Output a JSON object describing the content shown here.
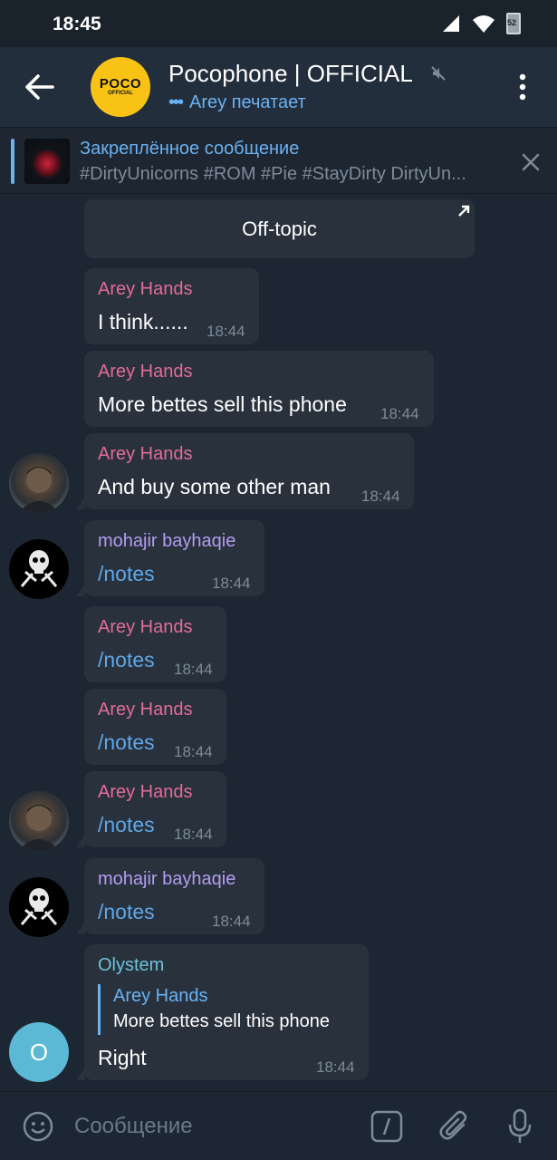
{
  "status_bar": {
    "time": "18:45",
    "battery": "52"
  },
  "header": {
    "title": "Pocophone | OFFICIAL",
    "avatar_logo": "POCO",
    "avatar_logo_sub": "OFFICIAL",
    "typing_dots": "•••",
    "status": "Arey печатает"
  },
  "pinned": {
    "title": "Закреплённое сообщение",
    "text": "#DirtyUnicorns #ROM #Pie #StayDirty DirtyUn..."
  },
  "topic": {
    "label": "Off-topic"
  },
  "messages": [
    {
      "sender": "Arey Hands",
      "text": "I think......",
      "time": "18:44"
    },
    {
      "sender": "Arey Hands",
      "text": "More bettes sell this phone",
      "time": "18:44"
    },
    {
      "sender": "Arey Hands",
      "text": "And buy some other man",
      "time": "18:44"
    },
    {
      "sender": "mohajir bayhaqie",
      "text": "/notes",
      "time": "18:44"
    },
    {
      "sender": "Arey Hands",
      "text": "/notes",
      "time": "18:44"
    },
    {
      "sender": "Arey Hands",
      "text": "/notes",
      "time": "18:44"
    },
    {
      "sender": "Arey Hands",
      "text": "/notes",
      "time": "18:44"
    },
    {
      "sender": "mohajir bayhaqie",
      "text": "/notes",
      "time": "18:44"
    },
    {
      "sender": "Olystem",
      "reply_name": "Arey Hands",
      "reply_text": "More bettes sell this phone",
      "text": "Right",
      "time": "18:44",
      "avatar_letter": "O"
    }
  ],
  "input": {
    "placeholder": "Сообщение"
  },
  "colors": {
    "background": "#1d2733",
    "header": "#232e3c",
    "bubble": "#28313c",
    "accent": "#6ab2f2",
    "name_arey": "#e56b9a",
    "name_mohajir": "#b39cf0",
    "name_olystem": "#6bc4d9",
    "link": "#5fa7e8",
    "timestamp": "#7d8b99"
  },
  "icons": [
    "back-arrow-icon",
    "mute-icon",
    "more-vert-icon",
    "close-icon",
    "open-topic-icon",
    "emoji-icon",
    "bot-command-icon",
    "attach-icon",
    "mic-icon",
    "signal-icon",
    "wifi-icon",
    "battery-icon"
  ]
}
